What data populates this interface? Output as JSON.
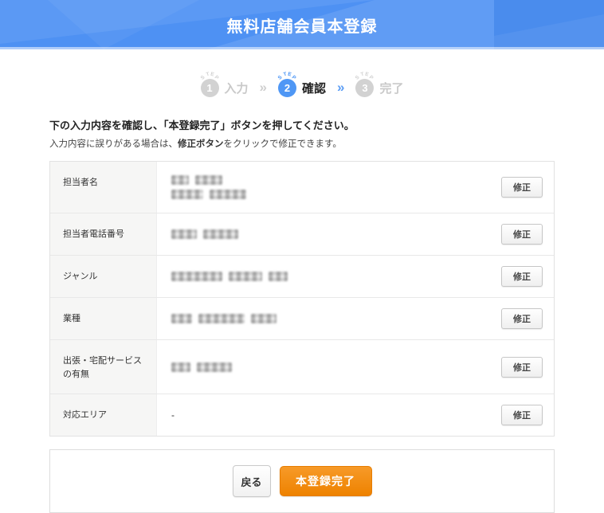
{
  "header": {
    "title": "無料店舗会員本登録",
    "bg_color": "#4e91f3"
  },
  "steps": {
    "step_word": "STEP",
    "separator": "»",
    "items": [
      {
        "number": "1",
        "label": "入力",
        "state": "inactive"
      },
      {
        "number": "2",
        "label": "確認",
        "state": "active"
      },
      {
        "number": "3",
        "label": "完了",
        "state": "inactive"
      }
    ]
  },
  "instructions": {
    "main": "下の入力内容を確認し、「本登録完了」ボタンを押してください。",
    "sub_pre": "入力内容に誤りがある場合は、",
    "sub_bold": "修正ボタン",
    "sub_post": "をクリックで修正できます。"
  },
  "table": {
    "edit_label": "修正",
    "rows": [
      {
        "label": "担当者名",
        "value": {
          "kind": "redacted",
          "lines": [
            [
              22,
              34
            ],
            [
              40,
              46
            ]
          ]
        }
      },
      {
        "label": "担当者電話番号",
        "value": {
          "kind": "redacted",
          "lines": [
            [
              32,
              44
            ]
          ]
        }
      },
      {
        "label": "ジャンル",
        "value": {
          "kind": "redacted",
          "lines": [
            [
              64,
              42,
              24
            ]
          ]
        }
      },
      {
        "label": "業種",
        "value": {
          "kind": "redacted",
          "lines": [
            [
              26,
              58,
              32
            ]
          ]
        }
      },
      {
        "label": "出張・宅配サービスの有無",
        "value": {
          "kind": "redacted",
          "lines": [
            [
              24,
              44
            ]
          ]
        }
      },
      {
        "label": "対応エリア",
        "value": {
          "kind": "text",
          "text": "-"
        }
      }
    ]
  },
  "footer": {
    "back_label": "戻る",
    "submit_label": "本登録完了"
  },
  "colors": {
    "accent_blue": "#4f97f5",
    "accent_orange": "#ee8200",
    "inactive_gray": "#d2d2d2"
  }
}
